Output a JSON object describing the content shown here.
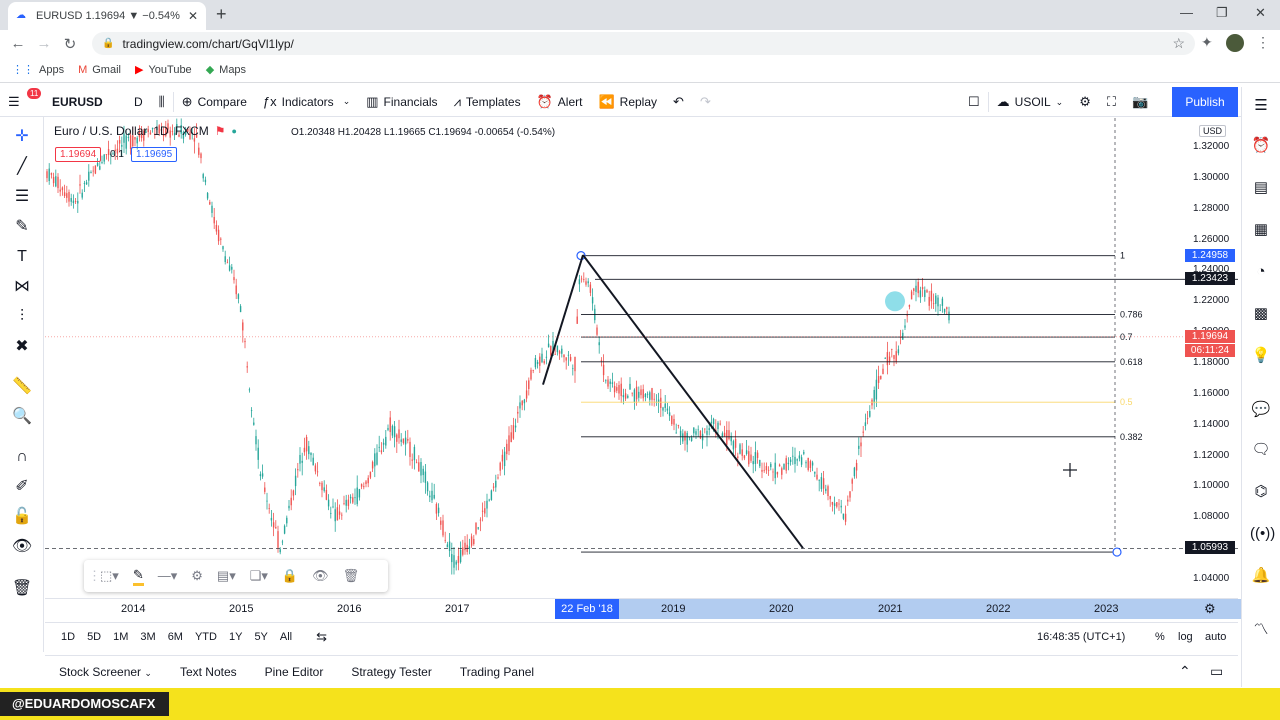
{
  "browser": {
    "tab_title": "EURUSD 1.19694 ▼ −0.54% USOIL",
    "url": "tradingview.com/chart/GqVl1lyp/",
    "bookmarks": [
      "Apps",
      "Gmail",
      "YouTube",
      "Maps"
    ]
  },
  "toolbar": {
    "notifications": "11",
    "symbol": "EURUSD",
    "interval": "D",
    "compare": "Compare",
    "indicators": "Indicators",
    "financials": "Financials",
    "templates": "Templates",
    "alert": "Alert",
    "replay": "Replay",
    "compare_symbol": "USOIL",
    "publish": "Publish"
  },
  "legend": {
    "title": "Euro / U.S. Dollar",
    "interval": "1D",
    "source": "FXCM",
    "ohlc": "O1.20348 H1.20428 L1.19665 C1.19694 -0.00654 (-0.54%)",
    "bid": "1.19694",
    "spread": "0.1",
    "ask": "1.19695"
  },
  "price_axis": {
    "currency": "USD",
    "labels": [
      "1.32000",
      "1.30000",
      "1.28000",
      "1.26000",
      "1.24000",
      "1.22000",
      "1.20000",
      "1.18000",
      "1.16000",
      "1.14000",
      "1.12000",
      "1.10000",
      "1.08000",
      "1.06000",
      "1.04000"
    ],
    "tag_fib_top": "1.24958",
    "tag_line": "1.23423",
    "tag_last": "1.19694",
    "tag_countdown": "06:11:24",
    "tag_crosshair": "1.05993"
  },
  "fib_levels": [
    {
      "label": "1",
      "price": 1.24958
    },
    {
      "label": "0.786",
      "price": 1.2114
    },
    {
      "label": "0.7",
      "price": 1.1968
    },
    {
      "label": "0.618",
      "price": 1.1808
    },
    {
      "label": "0.5",
      "price": 1.1546
    },
    {
      "label": "0.382",
      "price": 1.1322
    }
  ],
  "time_axis": {
    "labels": [
      "2014",
      "2015",
      "2016",
      "2017",
      "2019",
      "2020",
      "2021",
      "2022",
      "2023"
    ],
    "highlight": "22 Feb '18"
  },
  "timeframes": [
    "1D",
    "5D",
    "1M",
    "3M",
    "6M",
    "YTD",
    "1Y",
    "5Y",
    "All"
  ],
  "clock": "16:48:35 (UTC+1)",
  "scale_opts": [
    "%",
    "log",
    "auto"
  ],
  "bottom_tabs": [
    "Stock Screener",
    "Text Notes",
    "Pine Editor",
    "Strategy Tester",
    "Trading Panel"
  ],
  "watermark": "@EDUARDOMOSCAFX",
  "colors": {
    "accent": "#2962ff",
    "up": "#26a69a",
    "down": "#ef5350",
    "publish": "#2962ff"
  }
}
